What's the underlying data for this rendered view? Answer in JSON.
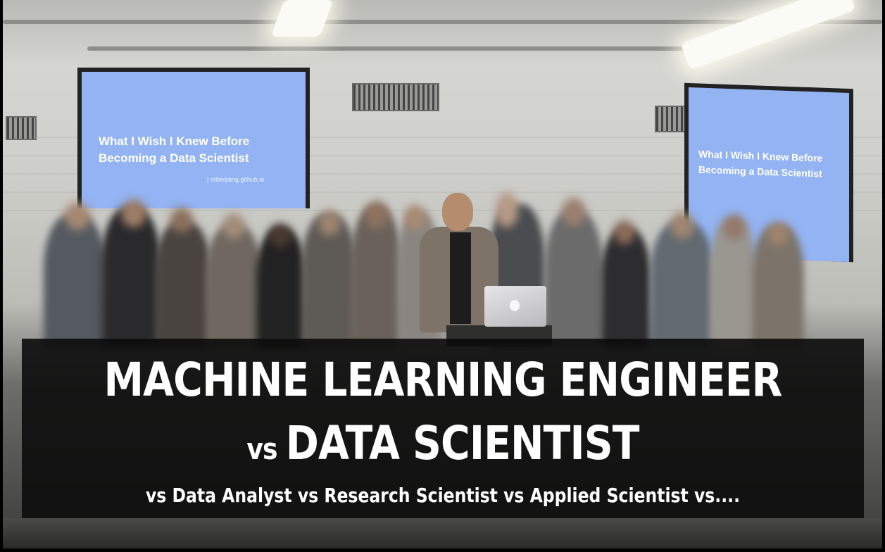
{
  "photo": {
    "left_slide": {
      "title_line1": "What I Wish I Knew Before",
      "title_line2": "Becoming a Data Scientist",
      "subtitle": "| roberjiang.github.io"
    },
    "right_slide": {
      "title_line1": "What I Wish I Knew Before",
      "title_line2": "Becoming a Data Scientist"
    },
    "colors": {
      "slide_blue": "#93b3f2",
      "overlay_black": "#0c0c0c",
      "text_white": "#ffffff"
    }
  },
  "overlay": {
    "line1": "MACHINE LEARNING ENGINEER",
    "line2_vs": "vs",
    "line2_main": "DATA SCIENTIST",
    "line3": "vs Data Analyst vs Research Scientist vs Applied Scientist vs...."
  }
}
